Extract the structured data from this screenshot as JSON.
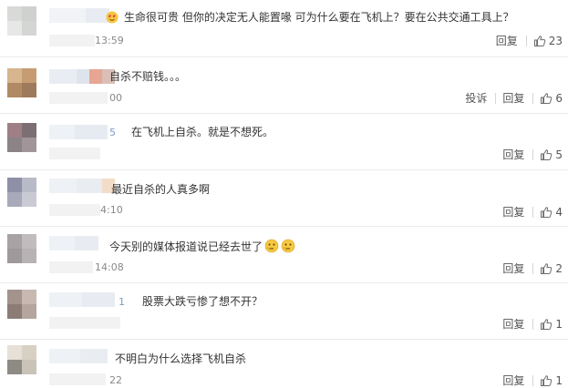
{
  "comments": [
    {
      "text": "生命很可贵 但你的决定无人能置喙 可为什么要在飞机上？要在公共交通工具上？",
      "time_fragment": "13:59",
      "reply_label": "回复",
      "like_count": "23",
      "report_label": ""
    },
    {
      "text": "自杀不赔钱。。。",
      "time_fragment": "00",
      "reply_label": "回复",
      "like_count": "6",
      "report_label": "投诉"
    },
    {
      "text": "在飞机上自杀。就是不想死。",
      "name_fragment": "5",
      "reply_label": "回复",
      "like_count": "5",
      "report_label": ""
    },
    {
      "text": "最近自杀的人真多啊",
      "time_fragment": "4:10",
      "reply_label": "回复",
      "like_count": "4",
      "report_label": ""
    },
    {
      "text": "今天别的媒体报道说已经去世了",
      "time_fragment": "14:08",
      "reply_label": "回复",
      "like_count": "2",
      "report_label": ""
    },
    {
      "text": "股票大跌亏惨了想不开？",
      "name_fragment": "1",
      "reply_label": "回复",
      "like_count": "1",
      "report_label": ""
    },
    {
      "text": "不明白为什么选择飞机自杀",
      "time_fragment": "22",
      "reply_label": "回复",
      "like_count": "1",
      "report_label": ""
    }
  ],
  "icons": {
    "like": "thumbs-up-icon",
    "emoji": "thinking-face-icon",
    "badge": "heart-eyes-badge-icon"
  },
  "colors": {
    "like": "#6b6b6b",
    "divider": "#ebebeb",
    "time": "#888888"
  }
}
